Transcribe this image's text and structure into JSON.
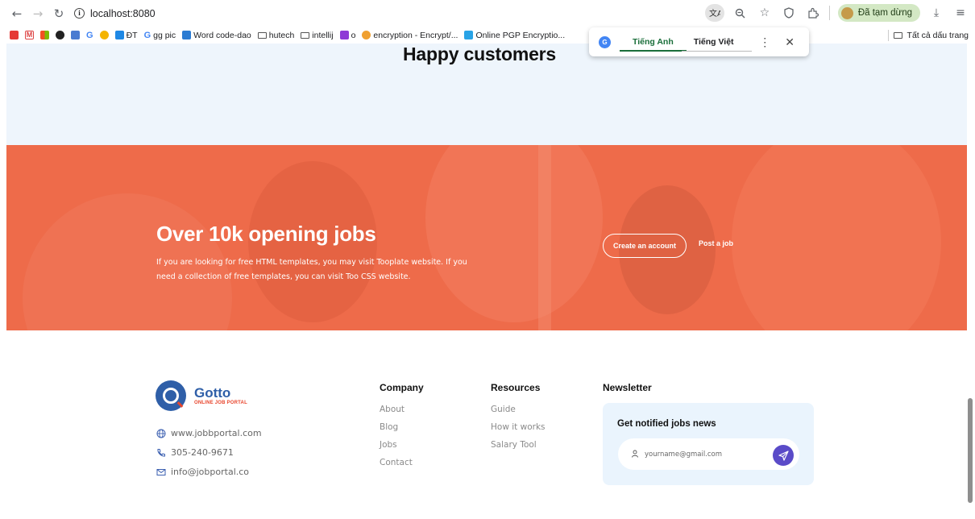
{
  "browser": {
    "url": "localhost:8080",
    "profile_label": "Đã tạm dừng",
    "bookmarks": [
      {
        "label": "ĐT"
      },
      {
        "label": "gg pic"
      },
      {
        "label": "Word code-dao"
      },
      {
        "label": "hutech"
      },
      {
        "label": "intellij"
      },
      {
        "label": "o"
      },
      {
        "label": "encryption - Encrypt/..."
      },
      {
        "label": "Online PGP Encryptio..."
      }
    ],
    "bookmarks_all": "Tất cả dấu trang"
  },
  "translate": {
    "lang_from": "Tiếng Anh",
    "lang_to": "Tiếng Việt"
  },
  "testimonials": {
    "title": "Happy customers"
  },
  "hero": {
    "title": "Over 10k opening jobs",
    "text": "If you are looking for free HTML templates, you may visit Tooplate website. If you need a collection of free templates, you can visit Too CSS website.",
    "create_button": "Create an account",
    "post_link": "Post a job",
    "color": "#ee6b4a"
  },
  "footer": {
    "brand_name": "Gotto",
    "brand_tagline": "ONLINE JOB PORTAL",
    "website": "www.jobbportal.com",
    "phone": "305-240-9671",
    "email": "info@jobportal.co",
    "company": {
      "heading": "Company",
      "links": [
        "About",
        "Blog",
        "Jobs",
        "Contact"
      ]
    },
    "resources": {
      "heading": "Resources",
      "links": [
        "Guide",
        "How it works",
        "Salary Tool"
      ]
    },
    "newsletter": {
      "heading": "Newsletter",
      "box_title": "Get notified jobs news",
      "placeholder": "yourname@gmail.com"
    }
  },
  "colors": {
    "accent": "#5a4bc8",
    "brand_blue": "#2f5fa8",
    "light_bg": "#eef5fc"
  }
}
